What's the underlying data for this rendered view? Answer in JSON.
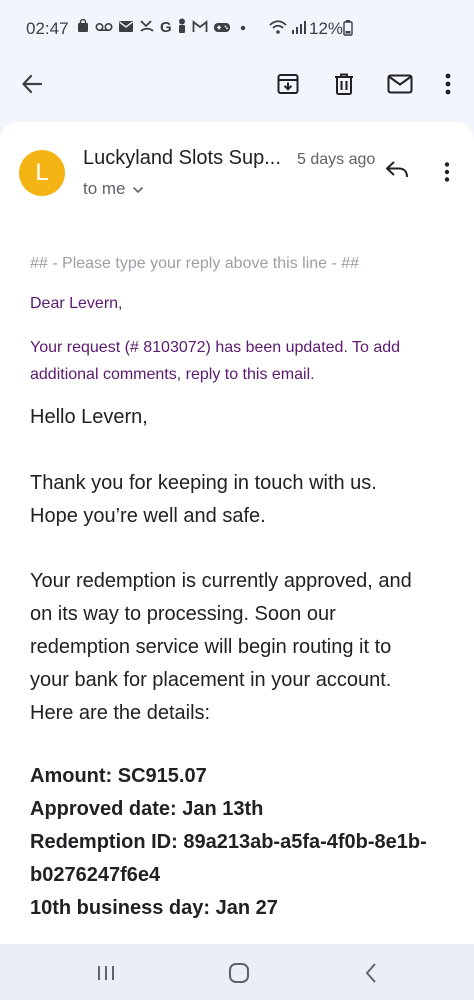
{
  "status_bar": {
    "time": "02:47",
    "battery": "12%",
    "icons": [
      "shopping-bag-icon",
      "voicemail-icon",
      "mail-icon",
      "missed-call-icon",
      "google-icon",
      "person-icon",
      "gmail-icon",
      "gamepad-icon",
      "dot-icon",
      "wifi-icon",
      "signal-icon",
      "battery-icon"
    ]
  },
  "app_bar": {
    "icons": [
      "back-arrow-icon",
      "archive-icon",
      "delete-icon",
      "mark-unread-icon",
      "more-vert-icon"
    ]
  },
  "email": {
    "avatar_letter": "L",
    "sender": "Luckyland Slots Sup...",
    "time": "5 days ago",
    "recipient": "to me",
    "reply_line": "## - Please type your reply above this line - ##",
    "greeting_purple": "Dear Levern,",
    "request_line1": "Your request (# 8103072) has been updated. To add",
    "request_line2": "additional comments, reply to this email.",
    "hello": "Hello Levern,",
    "thanks_line1": "Thank you for keeping in touch with us.",
    "thanks_line2": "Hope you’re well and safe.",
    "redemption_line1": "Your redemption is currently approved, and",
    "redemption_line2": "on its way to processing. Soon our",
    "redemption_line3": "redemption service will begin routing it to",
    "redemption_line4": "your bank for placement in your account.",
    "redemption_line5": "Here are the details:",
    "amount": "Amount: SC915.07",
    "approved_date": "Approved date: Jan 13th",
    "redemption_id_line1": "Redemption ID: 89a213ab-a5fa-4f0b-8e1b-",
    "redemption_id_line2": "b0276247f6e4",
    "business_day": "10th business day: Jan 27"
  },
  "nav_bar": {
    "icons": [
      "recent-apps-icon",
      "home-icon",
      "back-icon"
    ]
  },
  "colors": {
    "background": "#f2f5fb",
    "avatar": "#f3b414",
    "purple_text": "#5b1a6e"
  }
}
